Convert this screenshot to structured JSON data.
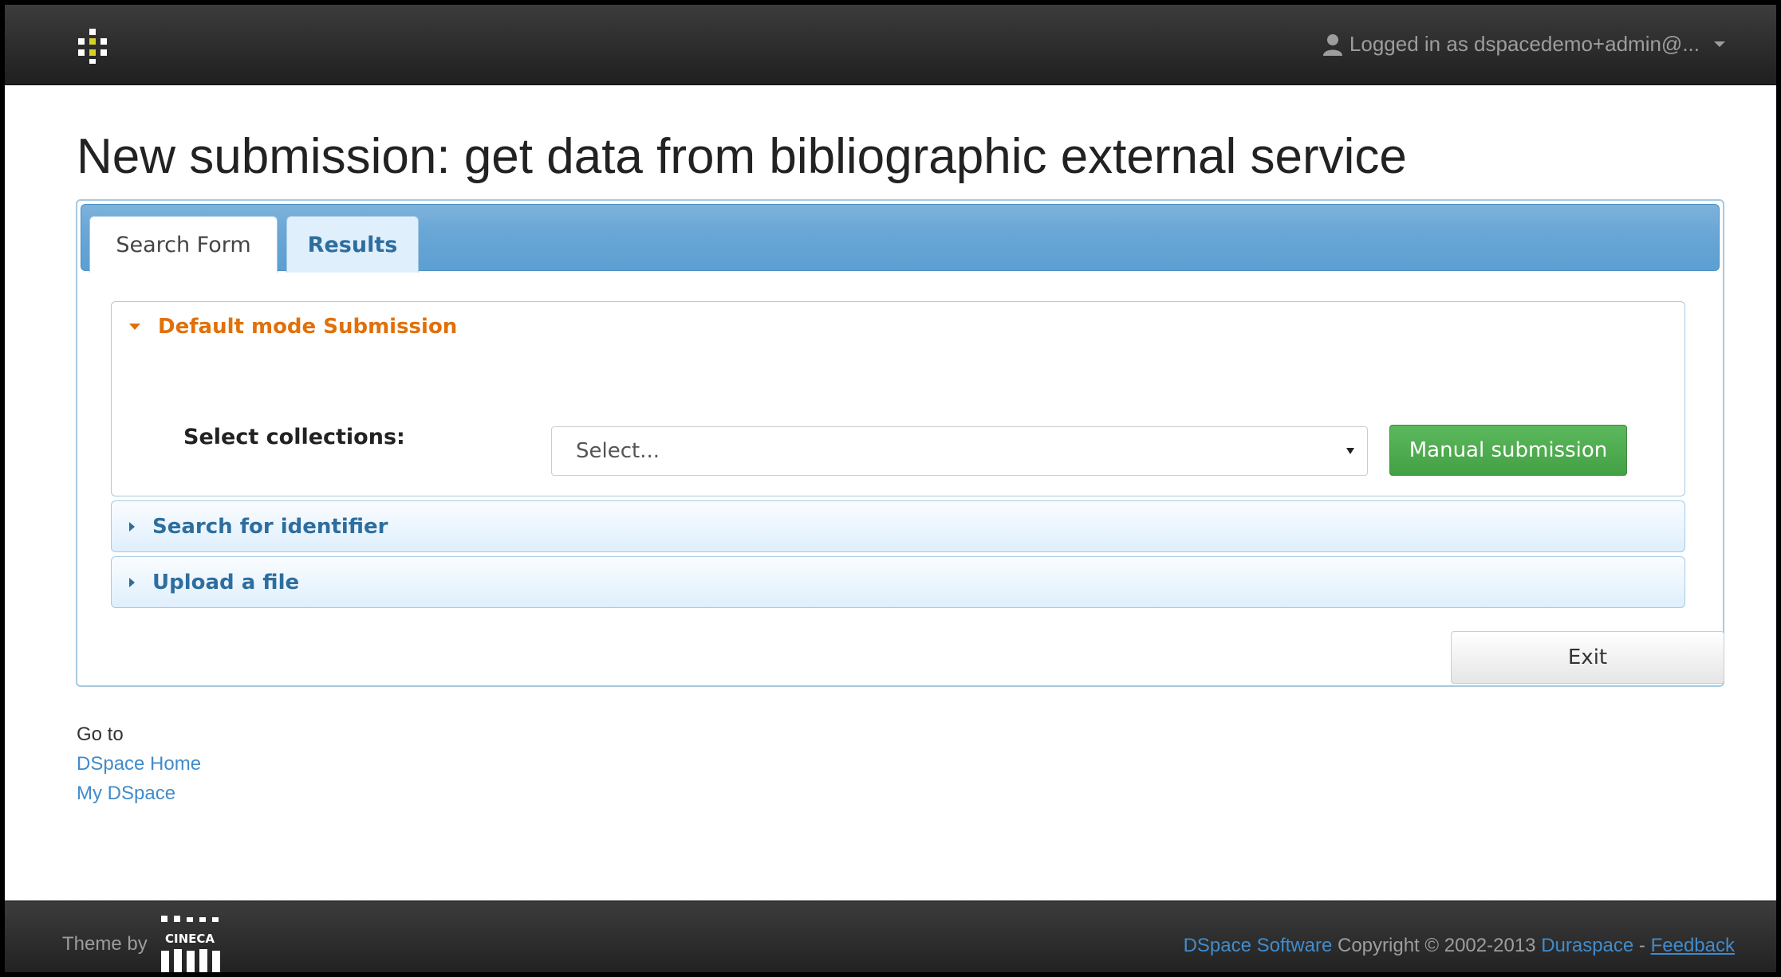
{
  "navbar": {
    "logo_icon": "dspace-logo-icon",
    "user_label": "Logged in as dspacedemo+admin@...",
    "user_icon": "user-icon"
  },
  "page": {
    "title": "New submission: get data from bibliographic external service"
  },
  "tabs": [
    {
      "label": "Search Form",
      "active": true
    },
    {
      "label": "Results",
      "active": false
    }
  ],
  "accordion": {
    "default": {
      "label": "Default mode Submission",
      "collections_label": "Select collections:",
      "select_value": "Select...",
      "manual_button": "Manual submission"
    },
    "identifier": {
      "label": "Search for identifier"
    },
    "upload": {
      "label": "Upload a file"
    }
  },
  "exit_button": "Exit",
  "goto": {
    "label": "Go to",
    "links": [
      "DSpace Home",
      "My DSpace"
    ]
  },
  "footer": {
    "theme_by": "Theme by",
    "theme_logo_text": "CINECA",
    "dspace_software": "DSpace Software",
    "copyright": "Copyright © 2002-2013",
    "duraspace": "Duraspace",
    "separator": "-",
    "feedback": "Feedback"
  },
  "colors": {
    "accent_orange": "#e17009",
    "link_blue": "#428bca",
    "tab_blue": "#2e6e9e",
    "green_button": "#5cb85c"
  }
}
